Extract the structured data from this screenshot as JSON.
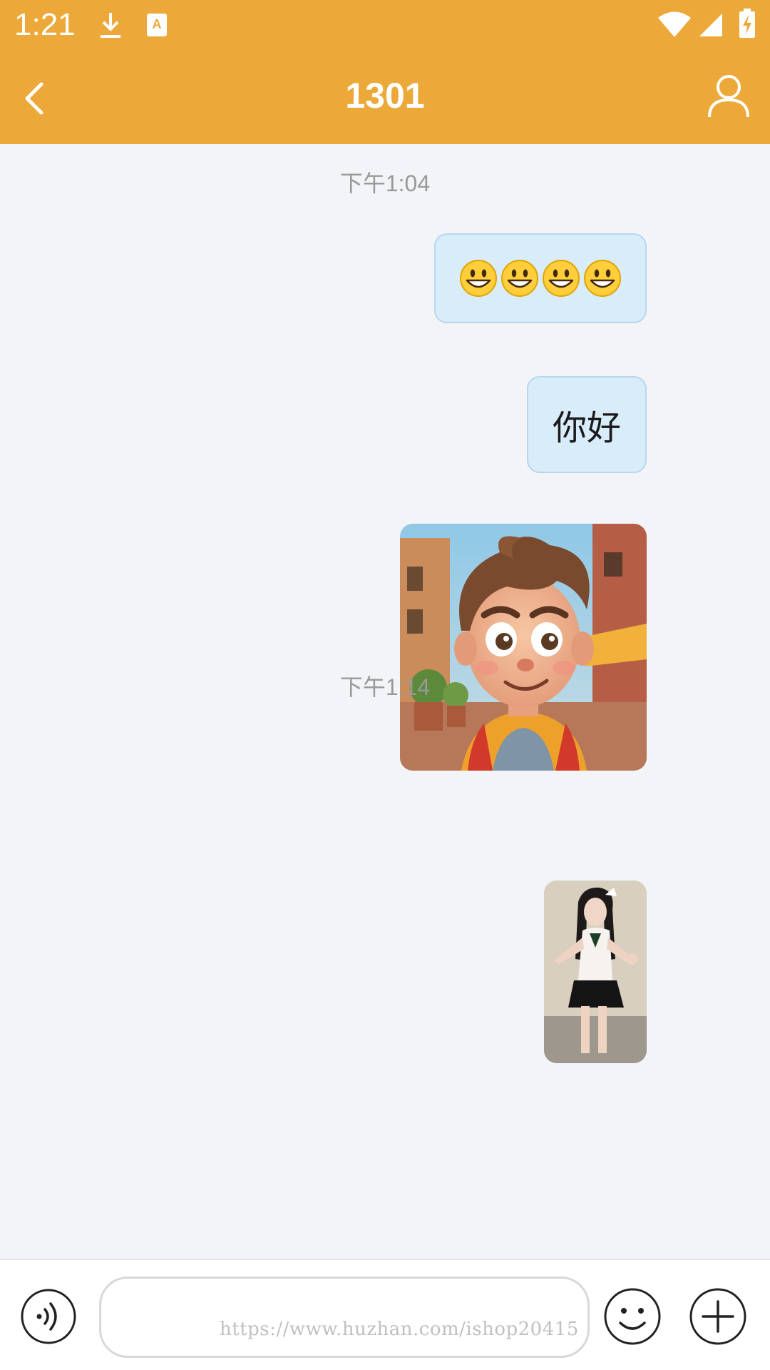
{
  "status_bar": {
    "time": "1:21",
    "icons": [
      "download-icon",
      "keyboard-a-icon",
      "wifi-icon",
      "signal-icon",
      "battery-charging-icon"
    ]
  },
  "header": {
    "title": "1301",
    "back_icon": "chevron-left-icon",
    "profile_icon": "person-icon",
    "background": "#eca93a"
  },
  "messages": [
    {
      "type": "timestamp",
      "text": "下午1:04"
    },
    {
      "type": "emoji",
      "sender": "me",
      "emoji": "grinning-face",
      "count": 4
    },
    {
      "type": "text",
      "sender": "me",
      "text": "你好"
    },
    {
      "type": "image",
      "sender": "me",
      "description": "cartoon-boy-photo"
    },
    {
      "type": "timestamp",
      "text": "下午1:14"
    },
    {
      "type": "image",
      "sender": "me",
      "description": "girl-photo"
    }
  ],
  "input_bar": {
    "value": "",
    "placeholder": "",
    "voice_icon": "voice-icon",
    "emoji_icon": "smiley-icon",
    "plus_icon": "plus-circle-icon"
  },
  "watermark": "https://www.huzhan.com/ishop20415",
  "colors": {
    "accent": "#eca93a",
    "bubble": "#d9ecfa",
    "chat_bg": "#f3f4f8"
  }
}
